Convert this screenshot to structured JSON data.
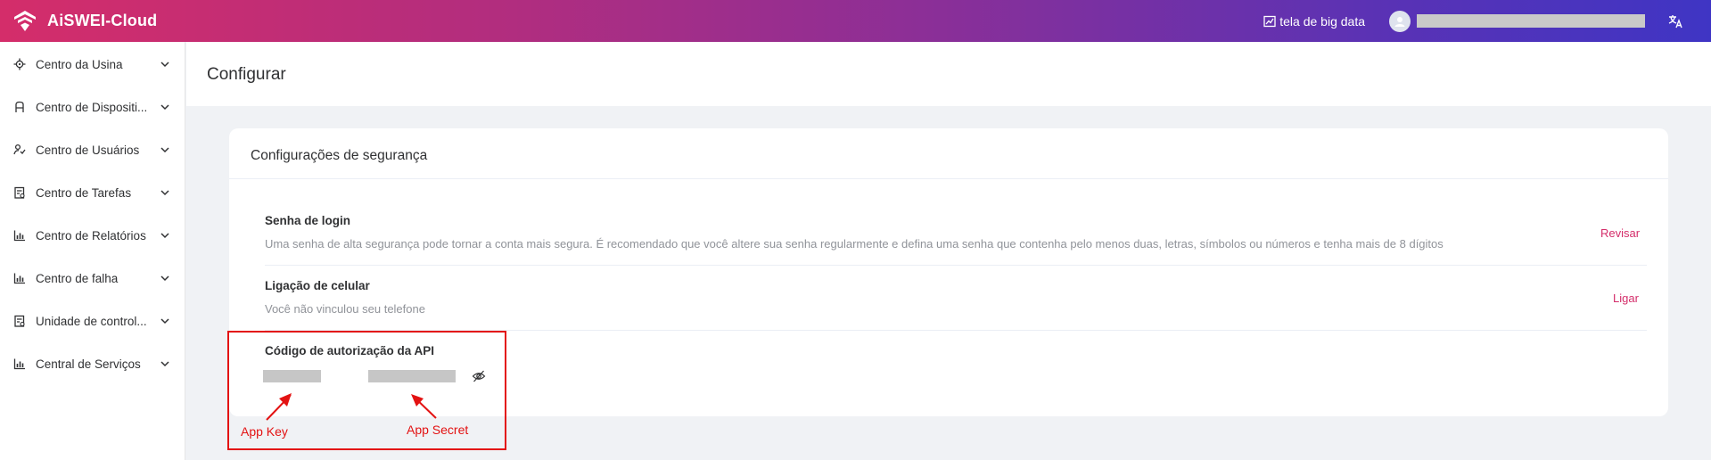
{
  "header": {
    "app_name": "AiSWEI-Cloud",
    "big_data_label": "tela de big data",
    "gradient_colors": [
      "#d42d6a",
      "#8a2f98",
      "#3f35c4"
    ]
  },
  "sidebar": {
    "items": [
      {
        "label": "Centro da Usina",
        "icon": "location-icon"
      },
      {
        "label": "Centro de Dispositi...",
        "icon": "device-icon"
      },
      {
        "label": "Centro de Usuários",
        "icon": "users-icon"
      },
      {
        "label": "Centro de Tarefas",
        "icon": "task-icon"
      },
      {
        "label": "Centro de Relatórios",
        "icon": "bar-chart-icon"
      },
      {
        "label": "Centro de falha",
        "icon": "bar-chart-icon"
      },
      {
        "label": "Unidade de control...",
        "icon": "document-icon"
      },
      {
        "label": "Central de Serviços",
        "icon": "bar-chart-icon"
      }
    ]
  },
  "page": {
    "title": "Configurar"
  },
  "security": {
    "title": "Configurações de segurança",
    "login_password": {
      "title": "Senha de login",
      "description": "Uma senha de alta segurança pode tornar a conta mais segura. É recomendado que você altere sua senha regularmente e defina uma senha que contenha pelo menos duas, letras, símbolos ou números e tenha mais de 8 dígitos",
      "action": "Revisar"
    },
    "phone_binding": {
      "title": "Ligação de celular",
      "description": "Você não vinculou seu telefone",
      "action": "Ligar"
    },
    "api_code": {
      "title": "Código de autorização da API"
    }
  },
  "annotations": {
    "app_key_label": "App Key",
    "app_secret_label": "App Secret",
    "color": "#e31212"
  },
  "colors": {
    "accent": "#d42d6a",
    "redaction": "#c6c6c6"
  }
}
